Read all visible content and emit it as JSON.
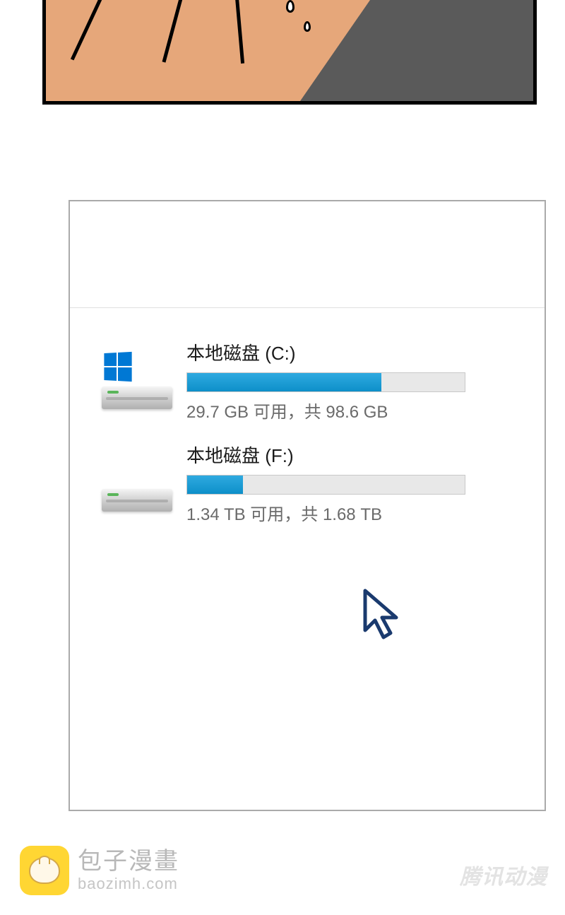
{
  "drives": [
    {
      "label": "本地磁盘 (C:)",
      "status": "29.7 GB 可用，共 98.6 GB",
      "fill_percent": 70,
      "has_windows_logo": true
    },
    {
      "label": "本地磁盘 (F:)",
      "status": "1.34 TB 可用，共 1.68 TB",
      "fill_percent": 20,
      "has_windows_logo": false
    }
  ],
  "watermark": {
    "baozi_title": "包子漫畫",
    "baozi_url": "baozimh.com",
    "tencent": "腾讯动漫"
  }
}
